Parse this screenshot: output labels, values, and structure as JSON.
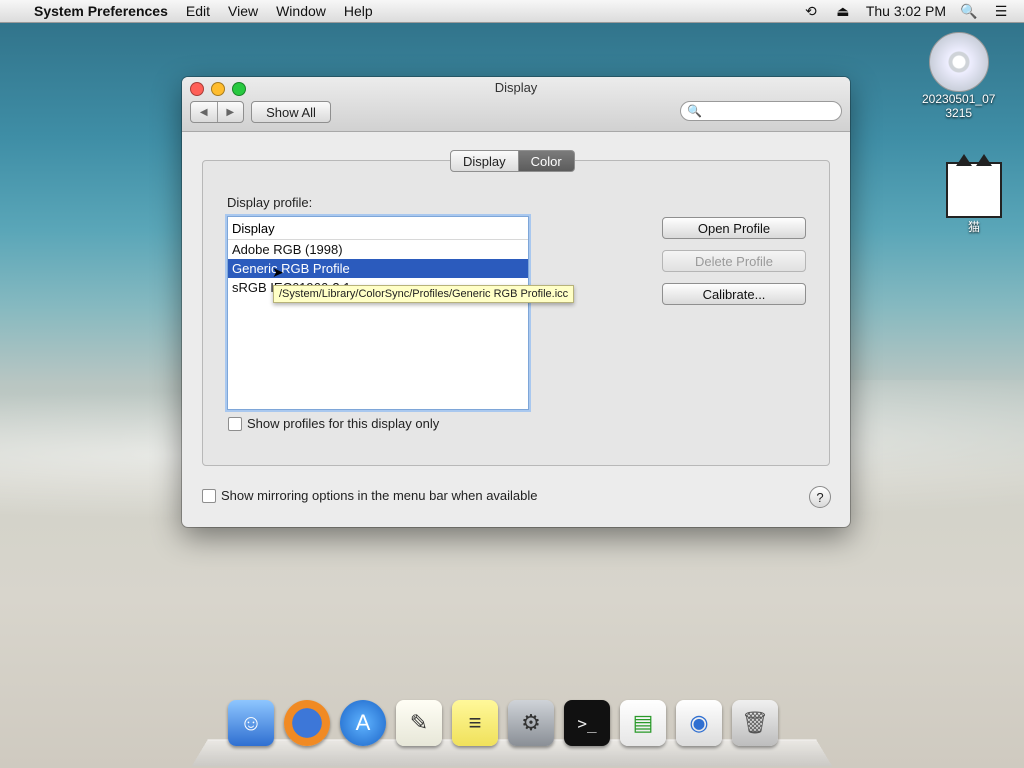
{
  "menubar": {
    "apple": "",
    "app": "System Preferences",
    "items": [
      "Edit",
      "View",
      "Window",
      "Help"
    ],
    "clock": "Thu 3:02 PM",
    "icons": [
      "time-machine-icon",
      "eject-icon",
      "spotlight-icon",
      "notification-icon"
    ]
  },
  "window": {
    "title": "Display",
    "show_all": "Show All",
    "search_placeholder": "",
    "tabs": [
      "Display",
      "Color"
    ],
    "active_tab": "Color",
    "profile_label": "Display profile:",
    "list_header": "Display",
    "profiles": [
      "Adobe RGB (1998)",
      "Generic RGB Profile",
      "sRGB IEC61966-2.1"
    ],
    "selected_profile": "Generic RGB Profile",
    "tooltip": "/System/Library/ColorSync/Profiles/Generic RGB Profile.icc",
    "buttons": {
      "open": "Open Profile",
      "delete": "Delete Profile",
      "calibrate": "Calibrate..."
    },
    "show_display_only": "Show profiles for this display only",
    "show_mirroring": "Show mirroring options in the menu bar when available",
    "help": "?"
  },
  "desktop": {
    "dvd_label_line1": "20230501_07",
    "dvd_label_line2": "3215",
    "cat_label": "猫"
  },
  "colors": {
    "selection": "#2b5bbd",
    "tooltip_bg": "#ffffc6",
    "menubar_bg": "#e9e9e9"
  },
  "dock": {
    "items": [
      "finder-icon",
      "firefox-icon",
      "app-store-icon",
      "textedit-icon",
      "stickies-icon",
      "system-preferences-icon",
      "terminal-icon",
      "document-icon",
      "web-document-icon",
      "trash-icon"
    ]
  }
}
